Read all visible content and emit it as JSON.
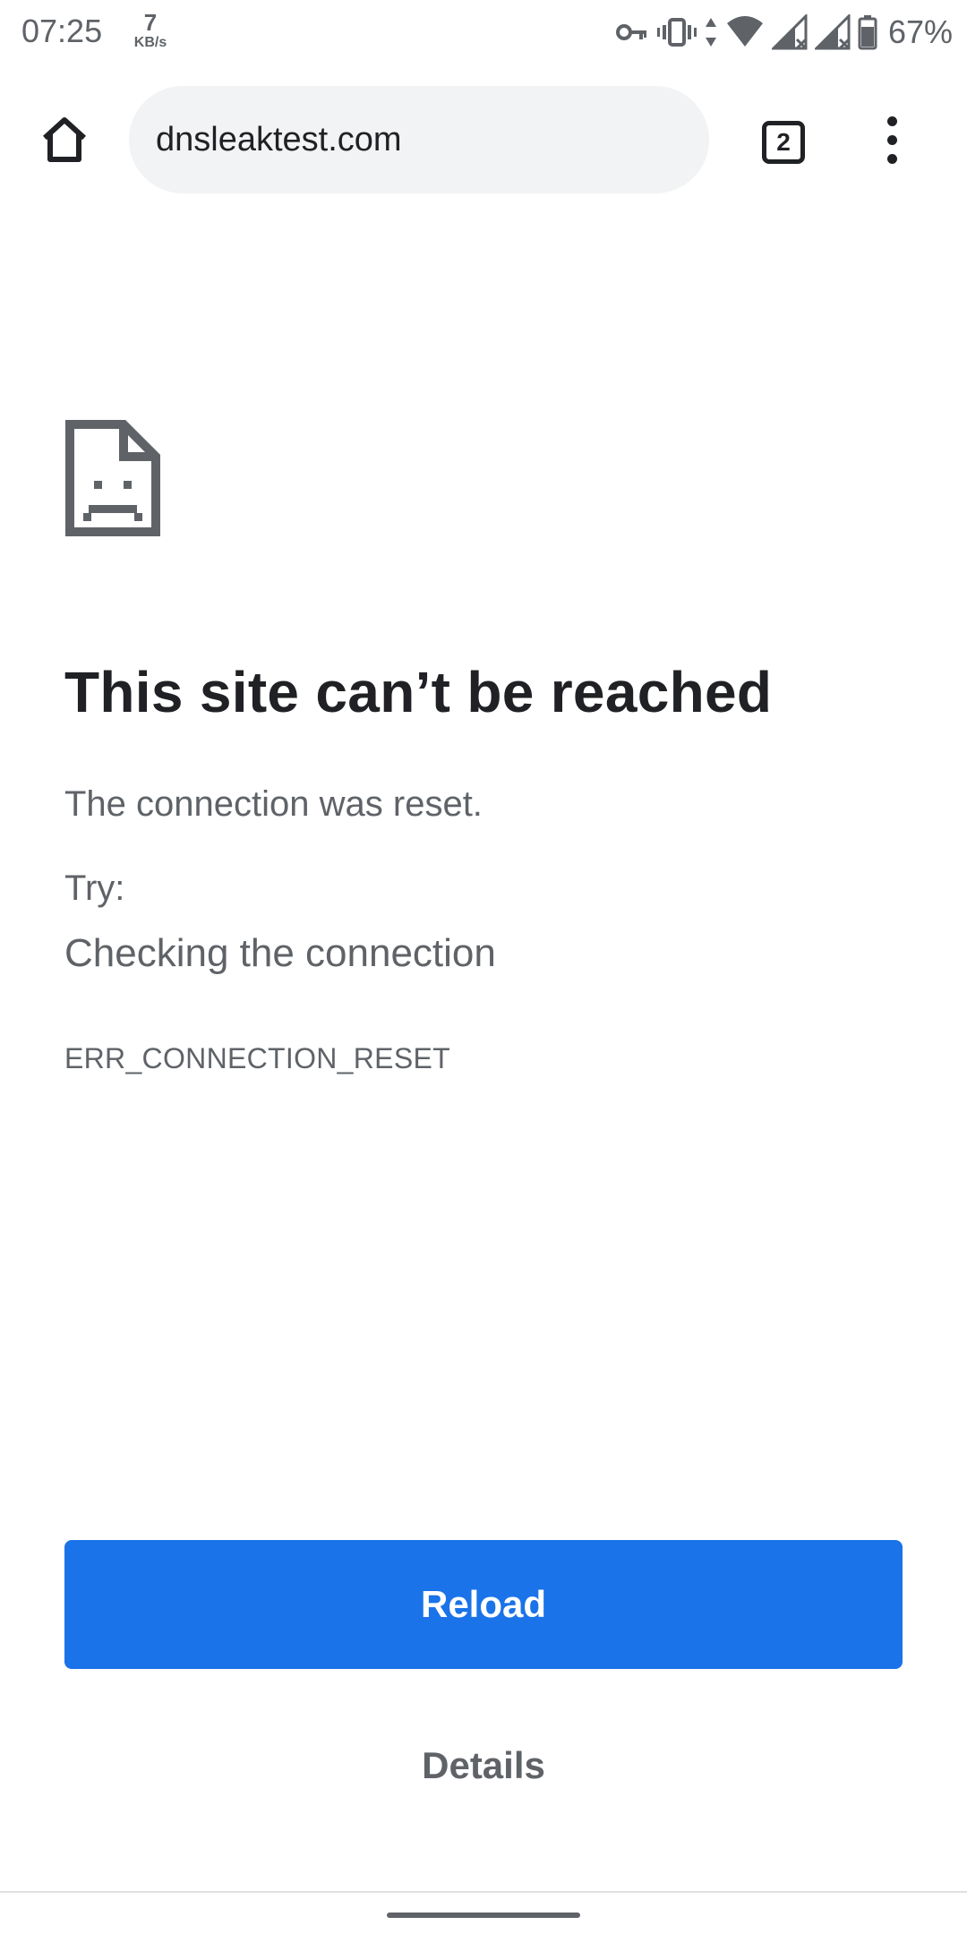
{
  "status_bar": {
    "time": "07:25",
    "net_speed_value": "7",
    "net_speed_unit": "KB/s",
    "icons": [
      "vpn-key-icon",
      "vibrate-icon",
      "data-arrows-icon",
      "wifi-icon",
      "signal-no-data-icon",
      "signal-no-data-icon",
      "battery-icon"
    ],
    "battery_percent": "67%"
  },
  "toolbar": {
    "url": "dnsleaktest.com",
    "tab_count": "2",
    "icons": [
      "home-icon",
      "tab-switcher-icon",
      "overflow-menu-icon"
    ]
  },
  "error_page": {
    "icon": "sad-page-icon",
    "title": "This site can’t be reached",
    "description": "The connection was reset.",
    "try_label": "Try:",
    "suggestion": "Checking the connection",
    "error_code": "ERR_CONNECTION_RESET",
    "reload_label": "Reload",
    "details_label": "Details"
  },
  "colors": {
    "accent": "#1a73e8",
    "text_primary": "#202124",
    "text_secondary": "#5f6368",
    "omnibox_bg": "#f1f3f4",
    "icon_gray": "#5f6368"
  }
}
